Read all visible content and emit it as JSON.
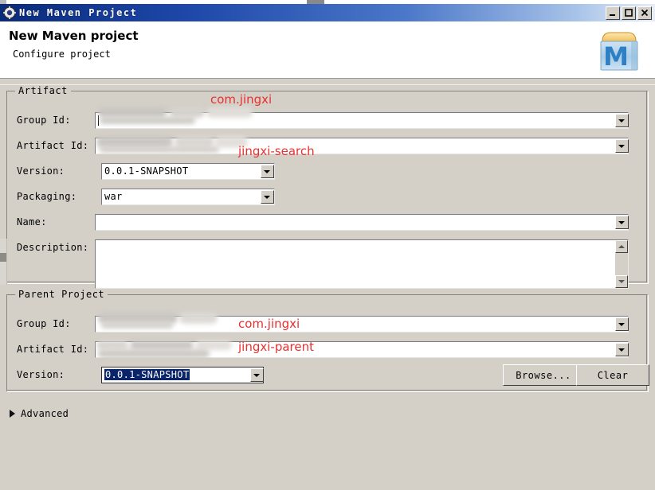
{
  "window": {
    "title": "New Maven Project",
    "icon": "maven-gear-icon",
    "controls": {
      "minimize": "_",
      "maximize": "□",
      "close": "✕"
    }
  },
  "header": {
    "title": "New Maven project",
    "subtitle": "Configure project",
    "icon": "maven-folder-m-icon"
  },
  "artifact": {
    "legend": "Artifact",
    "fields": [
      {
        "label": "Group Id:",
        "value": "",
        "redacted": true,
        "control": "combo"
      },
      {
        "label": "Artifact Id:",
        "value": "",
        "redacted": true,
        "control": "combo"
      },
      {
        "label": "Version:",
        "value": "0.0.1-SNAPSHOT",
        "redacted": false,
        "control": "combo"
      },
      {
        "label": "Packaging:",
        "value": "war",
        "redacted": false,
        "control": "combo"
      },
      {
        "label": "Name:",
        "value": "",
        "redacted": false,
        "control": "combo"
      },
      {
        "label": "Description:",
        "value": "",
        "redacted": false,
        "control": "textarea"
      }
    ]
  },
  "parent": {
    "legend": "Parent Project",
    "fields": [
      {
        "label": "Group Id:",
        "value": "",
        "redacted": true,
        "control": "combo"
      },
      {
        "label": "Artifact Id:",
        "value": "",
        "redacted": true,
        "control": "combo"
      },
      {
        "label": "Version:",
        "value": "0.0.1-SNAPSHOT",
        "redacted": false,
        "control": "combo",
        "selected": true
      }
    ],
    "buttons": {
      "browse": "Browse...",
      "clear": "Clear"
    }
  },
  "annotations": [
    {
      "text": "com.jingxi",
      "target": "artifact-group-id",
      "color": "#e83030"
    },
    {
      "text": "jingxi-search",
      "target": "artifact-artifact-id",
      "color": "#e83030"
    },
    {
      "text": "com.jingxi",
      "target": "parent-group-id",
      "color": "#e83030"
    },
    {
      "text": "jingxi-parent",
      "target": "parent-artifact-id",
      "color": "#e83030"
    }
  ],
  "advanced": {
    "label": "Advanced",
    "expanded": false
  },
  "colors": {
    "face": "#d4d0c8",
    "title_start": "#0a2a7a",
    "title_end": "#e8eef8",
    "annotation_red": "#e83030",
    "selection_blue": "#0a246a"
  }
}
